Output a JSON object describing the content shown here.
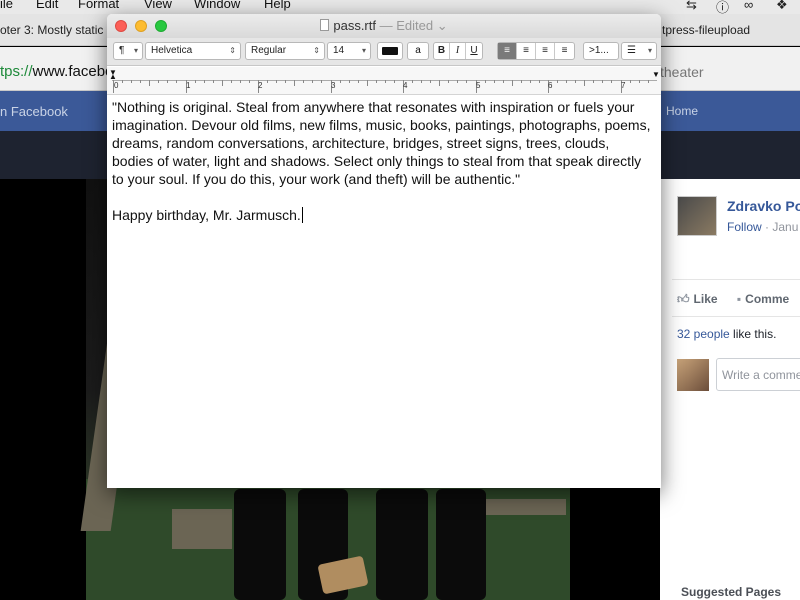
{
  "menubar": {
    "items": [
      "ile",
      "Edit",
      "Format",
      "View",
      "Window",
      "Help"
    ],
    "tray": [
      "sync-icon",
      "info-icon",
      "glasses-icon",
      "dropbox-icon"
    ]
  },
  "browser": {
    "tabs": [
      "oter 3: Mostly static",
      "tpress-fileupload"
    ],
    "url_scheme": "tps://",
    "url_rest": "www.facebo",
    "theater_label": "theater"
  },
  "facebook": {
    "search_placeholder": "n Facebook",
    "home_label": "Home",
    "post_author": "Zdravko Po",
    "follow_label": "Follow",
    "post_date": " · Janu",
    "like_label": "Like",
    "comment_label": "Comme",
    "likes_people": "32 people",
    "likes_suffix": " like this.",
    "comment_placeholder": "Write a comme",
    "suggested_pages": "Suggested Pages"
  },
  "textedit": {
    "filename": "pass.rtf",
    "edited_label": "— Edited",
    "toolbar": {
      "paragraph_style": "¶",
      "font_family": "Helvetica",
      "font_style": "Regular",
      "font_size": "14",
      "bg_color_label": "a",
      "bold": "B",
      "italic": "I",
      "underline": "U",
      "spacing": ">1...",
      "list": "☰"
    },
    "ruler_numbers": [
      "0",
      "1",
      "2",
      "3",
      "4",
      "5",
      "6",
      "7"
    ],
    "text_lines": [
      "\"Nothing is original. Steal from anywhere that resonates with inspiration or fuels your",
      "imagination. Devour old films, new films, music, books, paintings, photographs, poems,",
      "dreams, random conversations, architecture, bridges, street signs, trees, clouds,",
      "bodies of water, light and shadows. Select only things to steal from that speak directly",
      "to your soul. If you do this, your work (and theft) will be authentic.\""
    ],
    "closing_line": "Happy birthday, Mr. Jarmusch."
  }
}
